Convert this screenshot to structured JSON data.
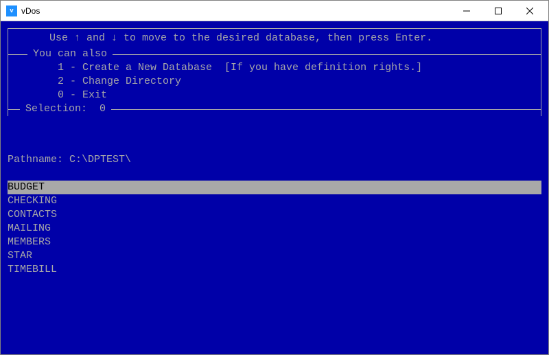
{
  "window": {
    "title": "vDos"
  },
  "instruction": "Use ↑ and ↓ to move to the desired database, then press Enter.",
  "menu": {
    "legend": "You can also",
    "options": [
      "1 - Create a New Database  [If you have definition rights.]",
      "2 - Change Directory",
      "0 - Exit"
    ],
    "selection_label": "Selection:  0"
  },
  "pathname_label": "Pathname: ",
  "pathname_value": "C:\\DPTEST\\",
  "databases": [
    {
      "name": "BUDGET",
      "selected": true
    },
    {
      "name": "CHECKING",
      "selected": false
    },
    {
      "name": "CONTACTS",
      "selected": false
    },
    {
      "name": "MAILING",
      "selected": false
    },
    {
      "name": "MEMBERS",
      "selected": false
    },
    {
      "name": "STAR",
      "selected": false
    },
    {
      "name": "TIMEBILL",
      "selected": false
    }
  ]
}
